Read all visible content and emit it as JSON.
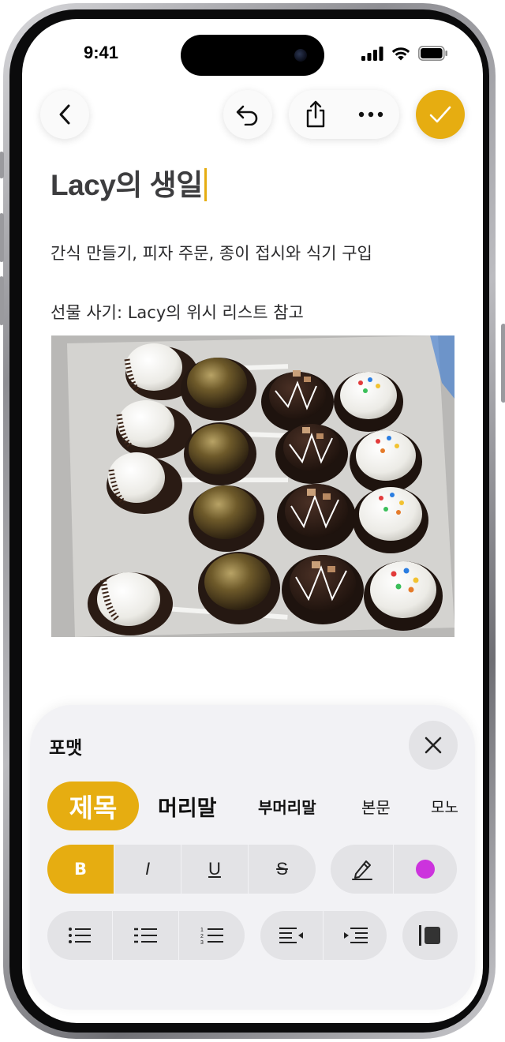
{
  "status_bar": {
    "time": "9:41"
  },
  "toolbar": {
    "back_icon": "chevron-left-icon",
    "undo_icon": "undo-arrow-icon",
    "share_icon": "share-icon",
    "more_icon": "ellipsis-icon",
    "done_icon": "checkmark-icon",
    "accent_color": "#e6ad11"
  },
  "note": {
    "title": "Lacy의 생일",
    "lines": [
      "간식 만들기, 피자 주문, 종이 접시와 식기 구입",
      "선물 사기: Lacy의 위시 리스트 참고"
    ],
    "image_subject": "cake pops in a box"
  },
  "format_panel": {
    "title": "포맷",
    "styles": [
      "제목",
      "머리말",
      "부머리말",
      "본문",
      "모노"
    ],
    "selected_style": "제목",
    "text_buttons": {
      "bold": "B",
      "italic": "I",
      "underline": "U",
      "strike": "S"
    },
    "bold_active": true,
    "color_dot": "#cc33dd"
  }
}
